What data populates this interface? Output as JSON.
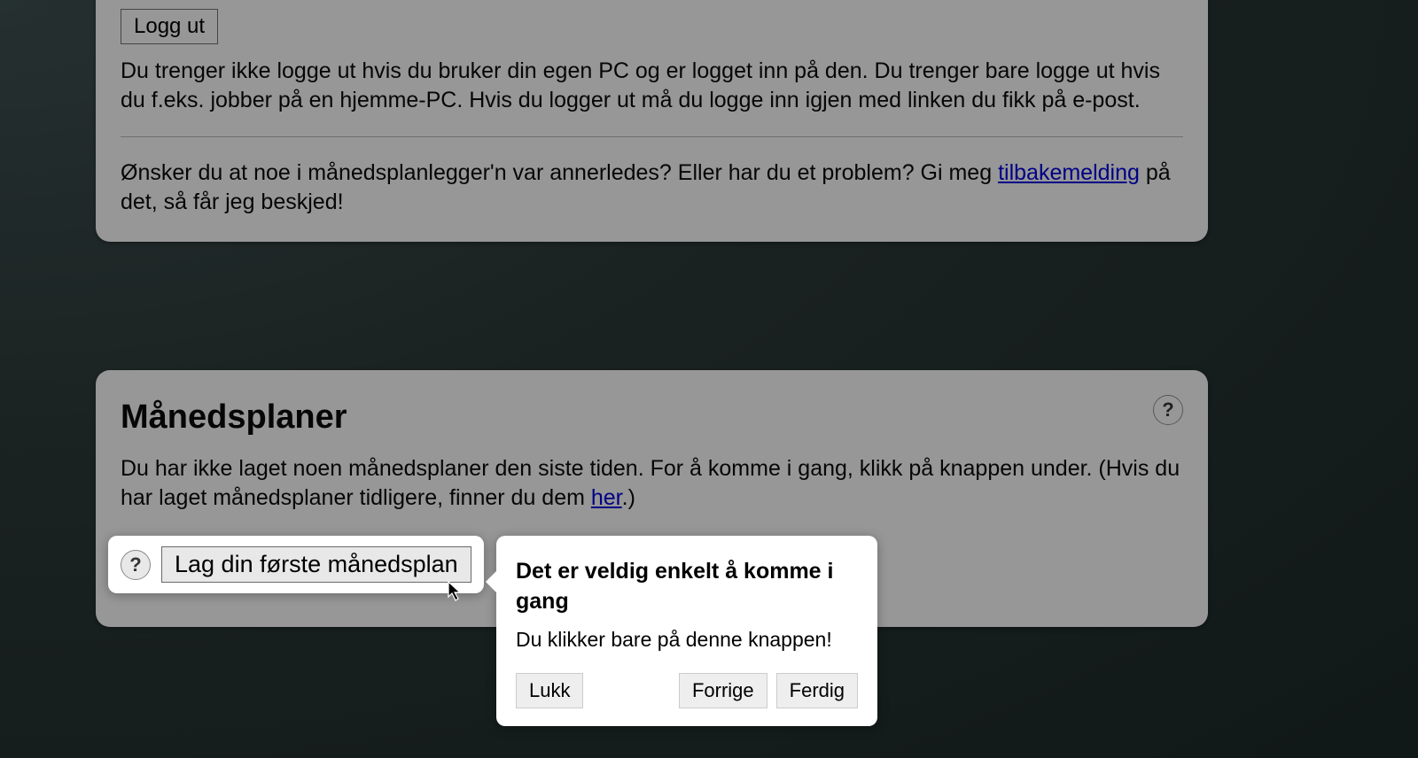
{
  "top_card": {
    "logout_button": "Logg ut",
    "logout_info": "Du trenger ikke logge ut hvis du bruker din egen PC og er logget inn på den. Du trenger bare logge ut hvis du f.eks. jobber på en hjemme-PC. Hvis du logger ut må du logge inn igjen med linken du fikk på e-post.",
    "feedback_pre": "Ønsker du at noe i månedsplanlegger'n var annerledes? Eller har du et problem? Gi meg ",
    "feedback_link": "tilbakemelding",
    "feedback_post": " på det, så får jeg beskjed!"
  },
  "bottom_card": {
    "title": "Månedsplaner",
    "help_icon": "?",
    "intro_pre": "Du har ikke laget noen månedsplaner den siste tiden. For å komme i gang, klikk på knappen under. (Hvis du har laget månedsplaner tidligere, finner du dem ",
    "intro_link": "her",
    "intro_post": ".)"
  },
  "highlight": {
    "help_icon": "?",
    "create_button": "Lag din første månedsplan"
  },
  "popover": {
    "title": "Det er veldig enkelt å komme i gang",
    "body": "Du klikker bare på denne knappen!",
    "close": "Lukk",
    "prev": "Forrige",
    "done": "Ferdig"
  }
}
